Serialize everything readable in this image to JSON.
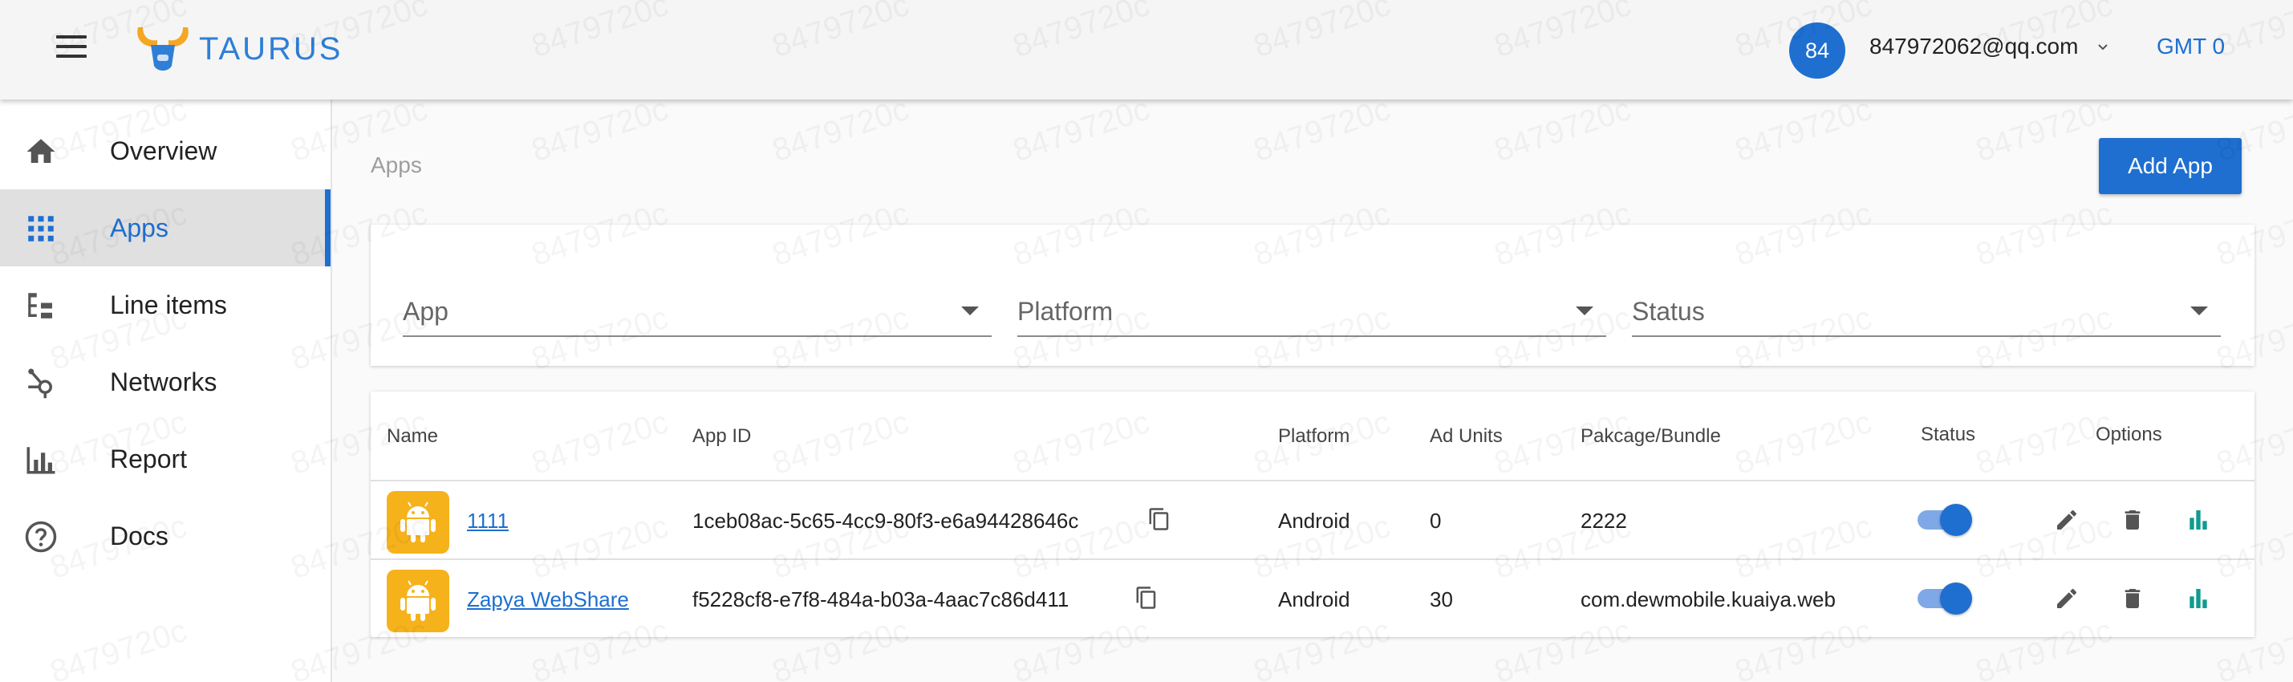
{
  "header": {
    "logo_text": "TAURUS",
    "avatar_initials": "84",
    "user_email": "847972062@qq.com",
    "timezone": "GMT 0"
  },
  "sidebar": {
    "items": [
      {
        "label": "Overview",
        "icon": "home-icon"
      },
      {
        "label": "Apps",
        "icon": "apps-grid-icon",
        "active": true
      },
      {
        "label": "Line items",
        "icon": "line-items-icon"
      },
      {
        "label": "Networks",
        "icon": "networks-icon"
      },
      {
        "label": "Report",
        "icon": "report-icon"
      },
      {
        "label": "Docs",
        "icon": "help-circle-icon"
      }
    ]
  },
  "main": {
    "breadcrumb": "Apps",
    "add_app_label": "Add App",
    "filters": {
      "app": "App",
      "platform": "Platform",
      "status": "Status"
    },
    "table": {
      "headers": {
        "name": "Name",
        "app_id": "App ID",
        "platform": "Platform",
        "ad_units": "Ad Units",
        "package": "Pakcage/Bundle",
        "status": "Status",
        "options": "Options"
      },
      "rows": [
        {
          "name": "1111",
          "app_id": "1ceb08ac-5c65-4cc9-80f3-e6a94428646c",
          "platform": "Android",
          "ad_units": "0",
          "package": "2222",
          "status_on": true
        },
        {
          "name": "Zapya WebShare",
          "app_id": "f5228cf8-e7f8-484a-b03a-4aac7c86d411",
          "platform": "Android",
          "ad_units": "30",
          "package": "com.dewmobile.kuaiya.web",
          "status_on": true
        }
      ]
    }
  },
  "watermark_text": "8479720c",
  "colors": {
    "primary": "#1e6fd0",
    "app_icon_bg": "#f6b21b",
    "report_icon": "#0f9b8e"
  }
}
